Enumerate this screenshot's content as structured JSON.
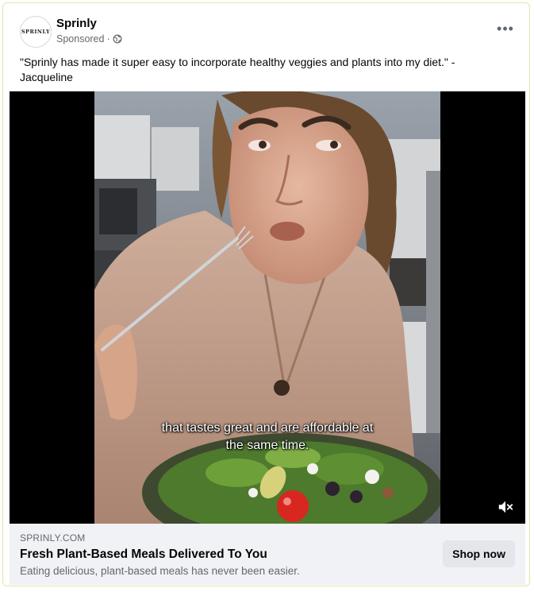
{
  "post": {
    "page_name": "Sprinly",
    "logo_text": "SPRINLY",
    "sponsored_label": "Sponsored",
    "dot": "·",
    "caption": "\"Sprinly has made it super easy to incorporate healthy veggies and plants into my diet.\"  - Jacqueline",
    "more_icon": "•••"
  },
  "video": {
    "subtitle_line1": "that tastes great and are affordable at",
    "subtitle_line2": "the same time."
  },
  "ad": {
    "domain": "SPRINLY.COM",
    "headline": "Fresh Plant-Based Meals Delivered To You",
    "description": "Eating delicious, plant-based meals has never been easier.",
    "cta": "Shop now"
  }
}
